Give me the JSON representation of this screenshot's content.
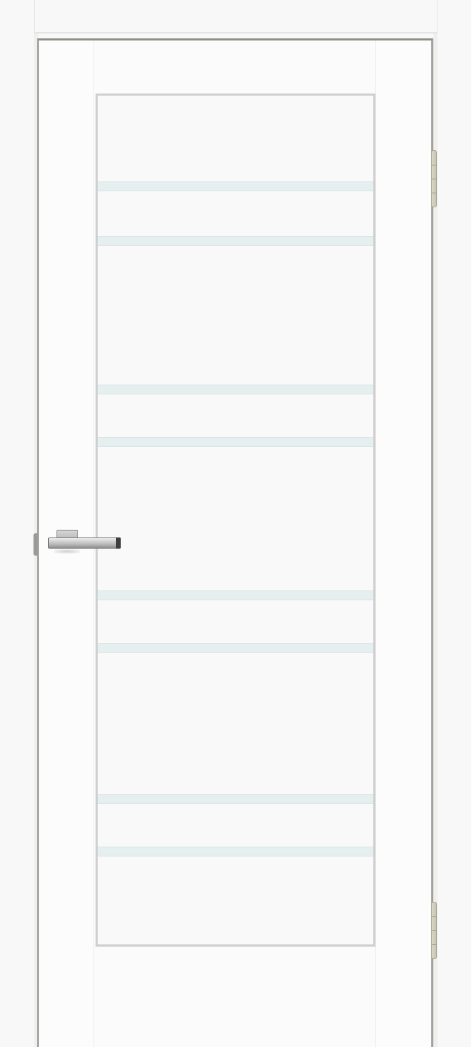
{
  "image": {
    "subject": "interior-door",
    "leaf_color": "#fafafa",
    "frame_color": "#a9a79f",
    "glass_color": "#e6efef",
    "glass_strip_count": 8,
    "hinge_count": 2,
    "handle_finish": "satin-nickel"
  }
}
